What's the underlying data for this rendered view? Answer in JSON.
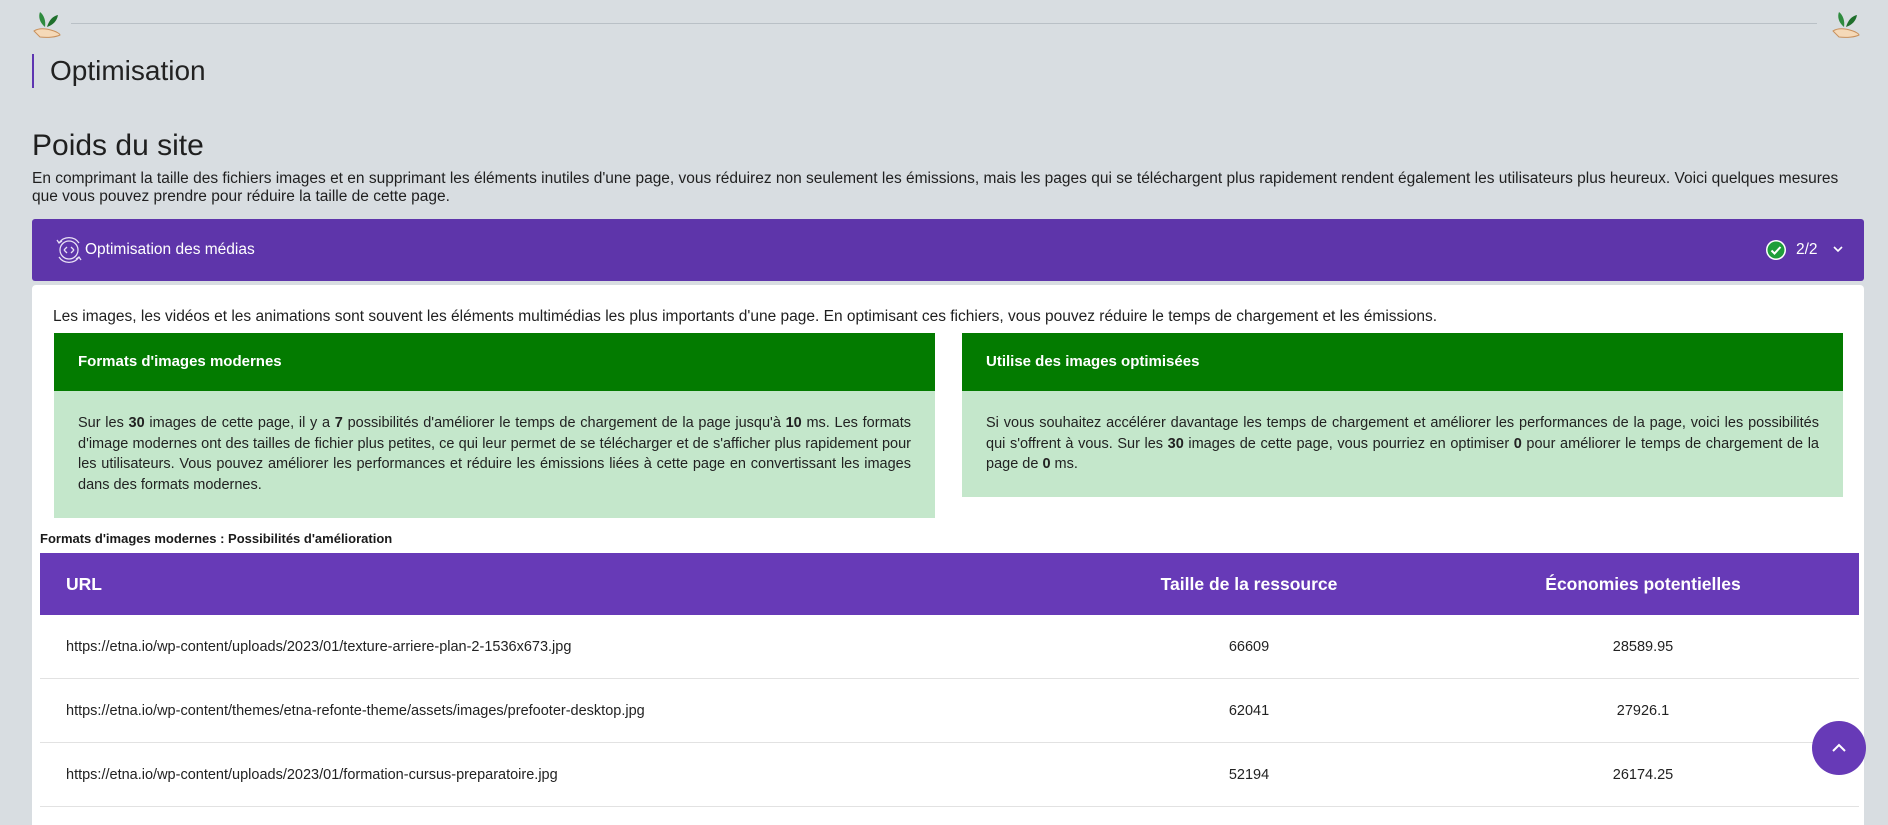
{
  "page": {
    "title": "Optimisation",
    "section_title": "Poids du site",
    "section_description": "En comprimant la taille des fichiers images et en supprimant les éléments inutiles d'une page, vous réduirez non seulement les émissions, mais les pages qui se téléchargent plus rapidement rendent également les utilisateurs plus heureux. Voici quelques mesures que vous pouvez prendre pour réduire la taille de cette page."
  },
  "accordion": {
    "title": "Optimisation des médias",
    "status_count": "2/2",
    "intro": "Les images, les vidéos et les animations sont souvent les éléments multimédias les plus importants d'une page. En optimisant ces fichiers, vous pouvez réduire le temps de chargement et les émissions."
  },
  "cards": {
    "modern_formats": {
      "title": "Formats d'images modernes",
      "text_1": "Sur les ",
      "images_count": "30",
      "text_2": " images de cette page, il y a ",
      "possibilities_count": "7",
      "text_3": " possibilités d'améliorer le temps de chargement de la page jusqu'à ",
      "ms_value": "10",
      "text_4": " ms. Les formats d'image modernes ont des tailles de fichier plus petites, ce qui leur permet de se télécharger et de s'afficher plus rapidement pour les utilisateurs. Vous pouvez améliorer les performances et réduire les émissions liées à cette page en convertissant les images dans des formats modernes."
    },
    "optimized_images": {
      "title": "Utilise des images optimisées",
      "text_1": "Si vous souhaitez accélérer davantage les temps de chargement et améliorer les performances de la page, voici les possibilités qui s'offrent à vous. Sur les ",
      "images_count": "30",
      "text_2": " images de cette page, vous pourriez en optimiser ",
      "optimizable_count": "0",
      "text_3": " pour améliorer le temps de chargement de la page de ",
      "ms_value": "0",
      "text_4": " ms."
    }
  },
  "table": {
    "caption": "Formats d'images modernes : Possibilités d'amélioration",
    "headers": [
      "URL",
      "Taille de la ressource",
      "Économies potentielles"
    ],
    "rows": [
      {
        "url": "https://etna.io/wp-content/uploads/2023/01/texture-arriere-plan-2-1536x673.jpg",
        "size": "66609",
        "savings": "28589.95"
      },
      {
        "url": "https://etna.io/wp-content/themes/etna-refonte-theme/assets/images/prefooter-desktop.jpg",
        "size": "62041",
        "savings": "27926.1"
      },
      {
        "url": "https://etna.io/wp-content/uploads/2023/01/formation-cursus-preparatoire.jpg",
        "size": "52194",
        "savings": "26174.25"
      }
    ]
  },
  "colors": {
    "accent_purple": "#5e35aa",
    "table_header_purple": "#673ab7",
    "card_header_green": "#037b00",
    "card_body_green": "#c4e7cb",
    "background": "#d8dde1"
  },
  "icons": {
    "leaf": "leaf-hand-icon",
    "media": "media-optimization-icon",
    "status": "check-circle-icon",
    "toggle": "chevron-down-icon",
    "scroll": "chevron-up-icon"
  }
}
